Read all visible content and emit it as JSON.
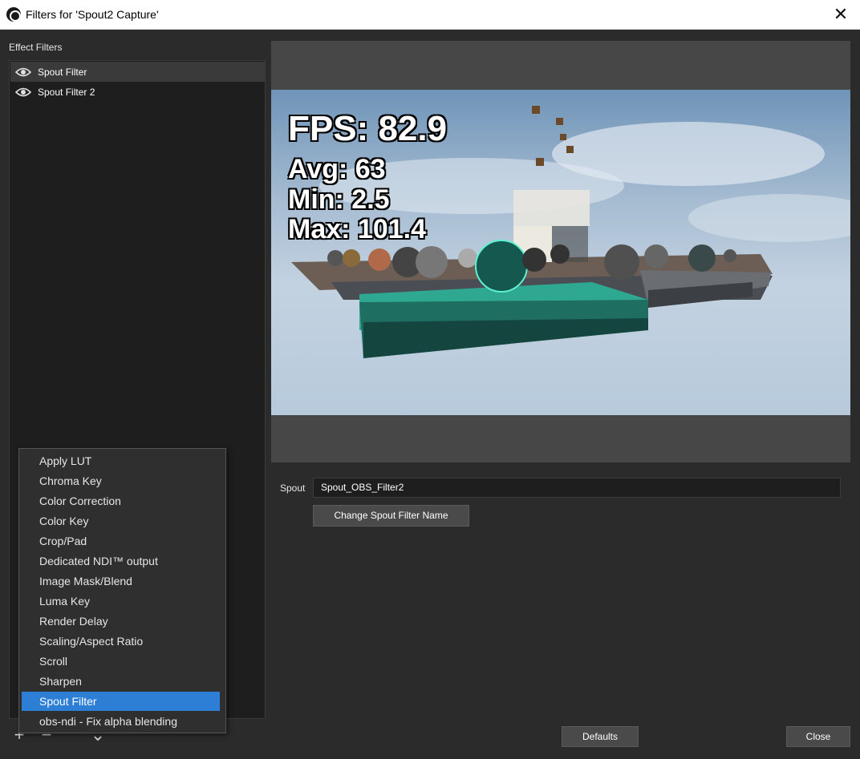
{
  "window": {
    "title": "Filters for 'Spout2 Capture'"
  },
  "filters": {
    "section_label": "Effect Filters",
    "items": [
      {
        "label": "Spout Filter",
        "selected": true
      },
      {
        "label": "Spout Filter 2",
        "selected": false
      }
    ]
  },
  "preview": {
    "fps": "FPS: 82.9",
    "avg": "Avg: 63",
    "min": "Min: 2.5",
    "max": "Max: 101.4"
  },
  "properties": {
    "spout_label": "Spout",
    "spout_value": "Spout_OBS_Filter2",
    "change_button": "Change Spout Filter Name"
  },
  "bottom": {
    "defaults_button": "Defaults",
    "close_button": "Close",
    "tools": [
      "plus-icon",
      "minus-icon",
      "chevron-up-icon",
      "chevron-down-icon"
    ]
  },
  "add_menu": {
    "items": [
      "Apply LUT",
      "Chroma Key",
      "Color Correction",
      "Color Key",
      "Crop/Pad",
      "Dedicated NDI™ output",
      "Image Mask/Blend",
      "Luma Key",
      "Render Delay",
      "Scaling/Aspect Ratio",
      "Scroll",
      "Sharpen",
      "Spout Filter",
      "obs-ndi - Fix alpha blending"
    ],
    "highlighted": "Spout Filter"
  },
  "colors": {
    "highlight": "#2d7fd6",
    "background": "#2b2b2b"
  }
}
